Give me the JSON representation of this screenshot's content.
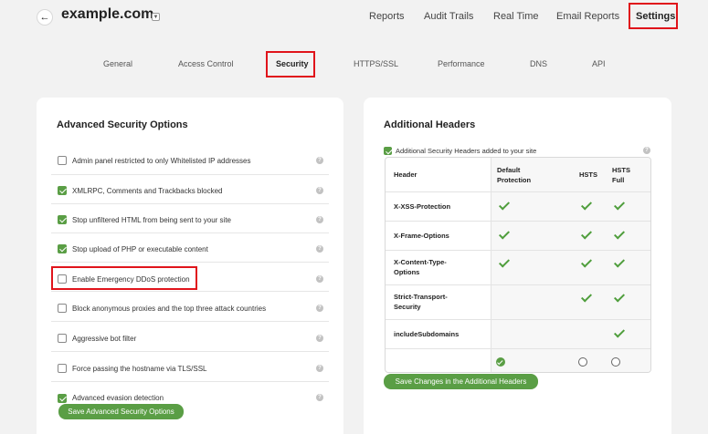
{
  "site": {
    "title": "example.com",
    "back_icon": "arrow-left-icon",
    "dropdown_icon": "chevron-down-icon"
  },
  "top_nav": [
    {
      "label": "Reports"
    },
    {
      "label": "Audit Trails"
    },
    {
      "label": "Real Time"
    },
    {
      "label": "Email Reports"
    },
    {
      "label": "Settings",
      "active": true
    }
  ],
  "sub_nav": [
    {
      "label": "General"
    },
    {
      "label": "Access Control"
    },
    {
      "label": "Security",
      "active": true
    },
    {
      "label": "HTTPS/SSL"
    },
    {
      "label": "Performance"
    },
    {
      "label": "DNS"
    },
    {
      "label": "API"
    }
  ],
  "security_options": {
    "title": "Advanced Security Options",
    "items": [
      {
        "label": "Admin panel restricted to only Whitelisted IP addresses",
        "checked": false
      },
      {
        "label": "XMLRPC, Comments and Trackbacks blocked",
        "checked": true
      },
      {
        "label": "Stop unfiltered HTML from being sent to your site",
        "checked": true
      },
      {
        "label": "Stop upload of PHP or executable content",
        "checked": true
      },
      {
        "label": "Enable Emergency DDoS protection",
        "checked": false
      },
      {
        "label": "Block anonymous proxies and the top three attack countries",
        "checked": false
      },
      {
        "label": "Aggressive bot filter",
        "checked": false
      },
      {
        "label": "Force passing the hostname via TLS/SSL",
        "checked": false
      },
      {
        "label": "Advanced evasion detection",
        "checked": true
      }
    ],
    "save_label": "Save Advanced Security Options",
    "help_icon": "help-icon"
  },
  "additional_headers": {
    "title": "Additional Headers",
    "enable_label": "Additional Security Headers added to your site",
    "enable_checked": true,
    "columns": [
      "Header",
      "Default\nProtection",
      "HSTS",
      "HSTS\nFull"
    ],
    "rows": [
      {
        "name": "X-XSS-Protection",
        "default": true,
        "hsts": true,
        "hsts_full": true
      },
      {
        "name": "X-Frame-Options",
        "default": true,
        "hsts": true,
        "hsts_full": true
      },
      {
        "name": "X-Content-Type-\nOptions",
        "default": true,
        "hsts": true,
        "hsts_full": true
      },
      {
        "name": "Strict-Transport-\nSecurity",
        "default": false,
        "hsts": true,
        "hsts_full": true
      },
      {
        "name": "includeSubdomains",
        "default": false,
        "hsts": false,
        "hsts_full": true
      }
    ],
    "selected_option": "Default Protection",
    "save_label": "Save Changes in the Additional Headers"
  }
}
